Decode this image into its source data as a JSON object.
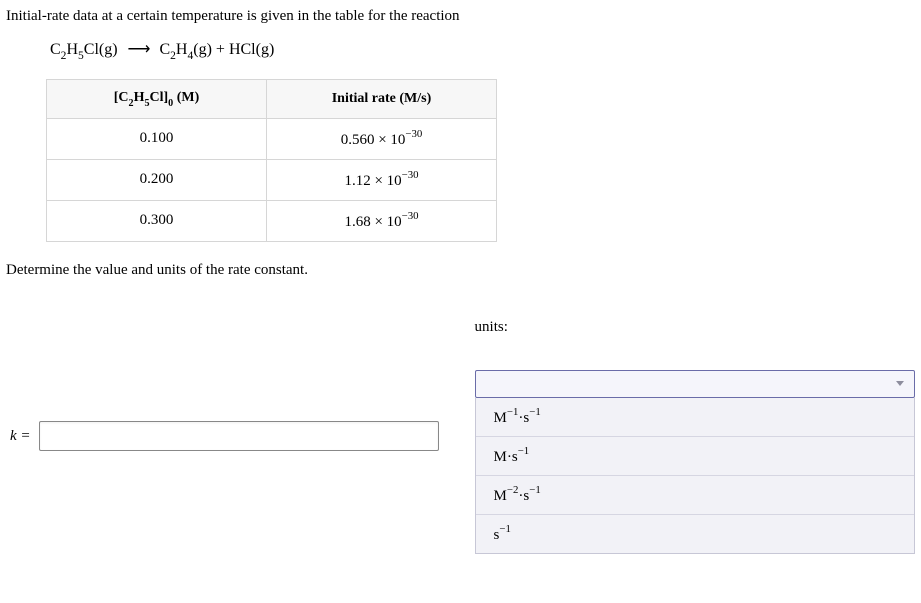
{
  "intro": "Initial-rate data at a certain temperature is given in the table for the reaction",
  "reaction": {
    "reactant_base": "C",
    "reactant_sub1": "2",
    "reactant_mid": "H",
    "reactant_sub2": "5",
    "reactant_end": "Cl(g)",
    "product1_base": "C",
    "product1_sub1": "2",
    "product1_mid": "H",
    "product1_sub2": "4",
    "product1_end": "(g)",
    "plus": " + ",
    "product2": "HCl(g)"
  },
  "table": {
    "header1_open": "[C",
    "header1_sub1": "2",
    "header1_mid1": "H",
    "header1_sub2": "5",
    "header1_mid2": "Cl]",
    "header1_sub3": "0",
    "header1_close": " (M)",
    "header2": "Initial rate (M/s)",
    "rows": [
      {
        "conc": "0.100",
        "rate_val": "0.560 × 10",
        "rate_exp": "−30"
      },
      {
        "conc": "0.200",
        "rate_val": "1.12 × 10",
        "rate_exp": "−30"
      },
      {
        "conc": "0.300",
        "rate_val": "1.68 × 10",
        "rate_exp": "−30"
      }
    ]
  },
  "question": "Determine the value and units of the rate constant.",
  "k_label_pre": "k",
  "k_label_post": " =",
  "k_value": "",
  "units_label": "units:",
  "dropdown": {
    "options": [
      {
        "pre": "M",
        "exp": "−1",
        "mid": "·s",
        "exp2": "−1"
      },
      {
        "pre": "M·s",
        "exp": "−1",
        "mid": "",
        "exp2": ""
      },
      {
        "pre": "M",
        "exp": "−2",
        "mid": "·s",
        "exp2": "−1"
      },
      {
        "pre": "s",
        "exp": "−1",
        "mid": "",
        "exp2": ""
      }
    ]
  }
}
